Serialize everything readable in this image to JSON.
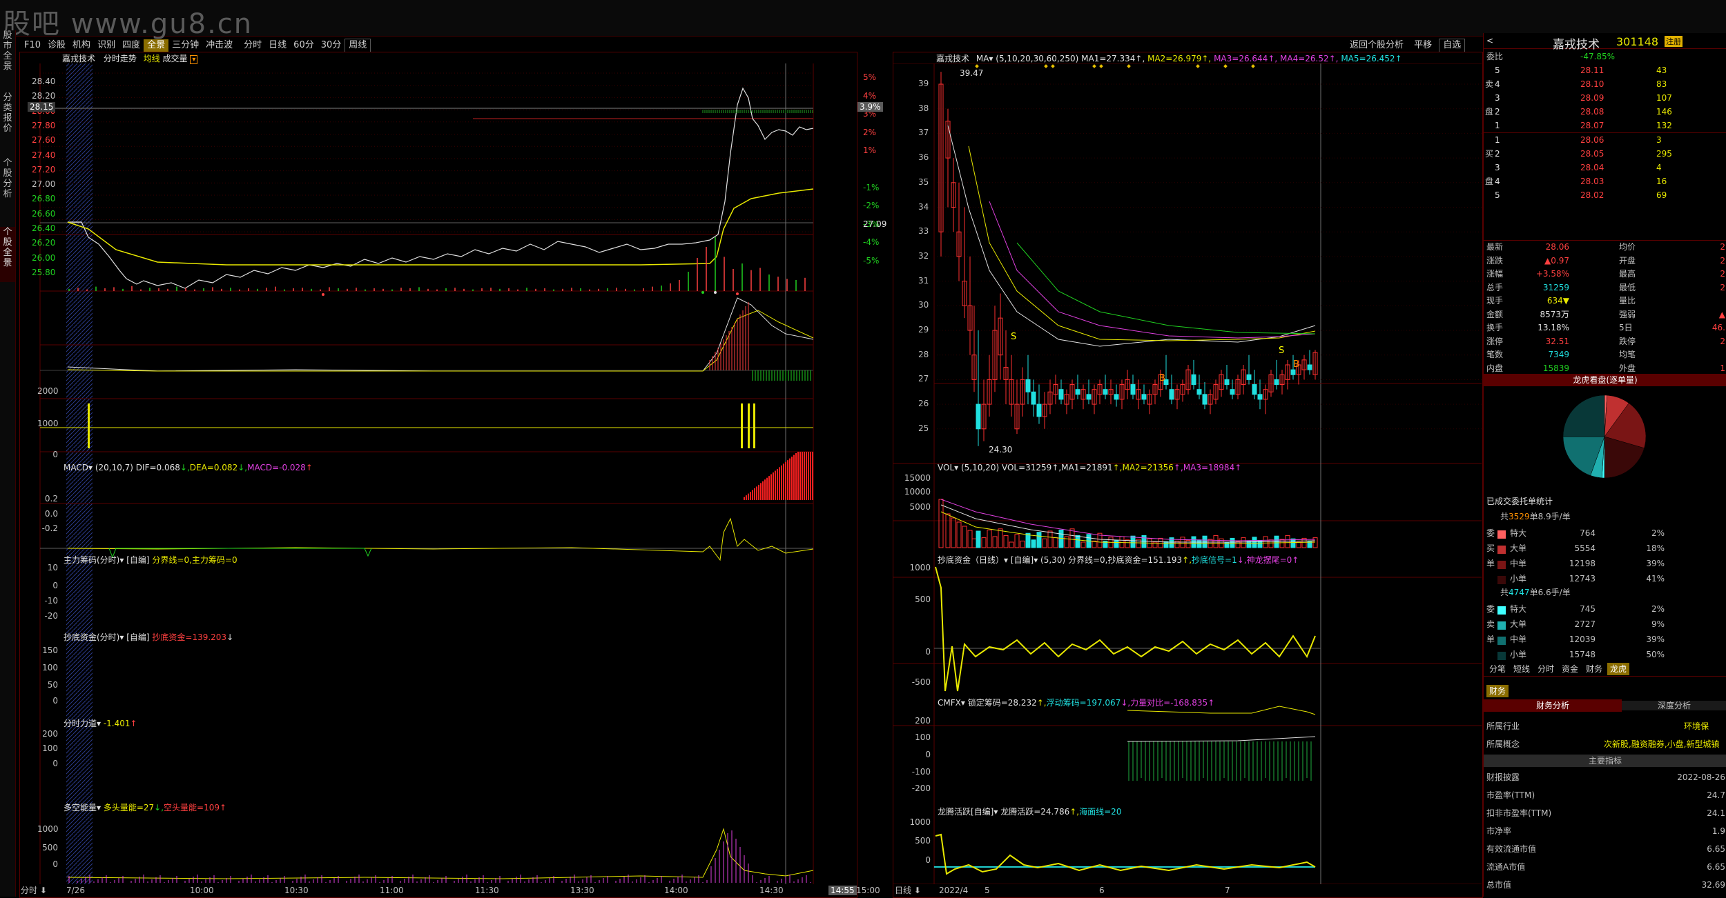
{
  "watermark": "股吧 www.gu8.cn",
  "nav": {
    "items": [
      "F10",
      "诊股",
      "机构",
      "识别",
      "四度",
      "全景",
      "三分钟",
      "冲击波",
      "分时",
      "日线",
      "60分",
      "30分",
      "周线"
    ],
    "active": "全景",
    "right_items": [
      "返回个股分析",
      "平移",
      "自选"
    ]
  },
  "left_tabs": [
    "股市全景",
    "分类报价",
    "个股分析",
    "个股全景"
  ],
  "left_chart": {
    "title": "嘉戎技术",
    "subtitle": "分时走势",
    "avg_label": "均线",
    "vol_label": "成交量",
    "price_ticks": [
      "28.40",
      "28.20",
      "28.00",
      "27.80",
      "27.60",
      "27.40",
      "27.20",
      "27.00",
      "26.80",
      "26.60",
      "26.40",
      "26.20",
      "26.00",
      "25.80"
    ],
    "pct_ticks": [
      "5%",
      "4%",
      "3%",
      "2%",
      "1%",
      "",
      "-1%",
      "-2%",
      "-3%",
      "-4%",
      "-5%"
    ],
    "pre_close": "27.09",
    "current_price": "28.15",
    "current_pct": "3.9%",
    "vol_ticks": [
      "2000",
      "1000",
      "0"
    ],
    "time_ticks": [
      "7/26",
      "10:00",
      "10:30",
      "11:00",
      "11:30",
      "13:30",
      "14:00",
      "14:30",
      "15:00"
    ],
    "time_marker": "14:55",
    "bottom_left": "分时"
  },
  "left_indicators": [
    {
      "name": "MACD",
      "text": "(20,10,7)",
      "dif": "DIF=0.068",
      "dea": "DEA=0.082",
      "macd": "MACD=-0.028",
      "ticks": [
        "0.2",
        "0.0",
        "-0.2"
      ]
    },
    {
      "name": "主力筹码(分时)",
      "text": "[自编]",
      "line": "分界线=0,主力筹码=0",
      "ticks": [
        "10",
        "0",
        "-10",
        "-20"
      ]
    },
    {
      "name": "抄底资金(分时)",
      "text": "[自编]",
      "line": "抄底资金=139.203",
      "ticks": [
        "150",
        "100",
        "50",
        "0"
      ]
    },
    {
      "name": "分时力道",
      "line": "-1.401",
      "ticks": [
        "200",
        "100",
        "0"
      ]
    },
    {
      "name": "多空能量",
      "line": "多头量能=27",
      "line2": "空头量能=109",
      "ticks": [
        "1000",
        "500",
        "0"
      ]
    }
  ],
  "right_chart": {
    "title": "嘉戎技术",
    "ma_label": "MA",
    "ma_params": "(5,10,20,30,60,250)",
    "ma1": "MA1=27.334",
    "ma2": "MA2=26.979",
    "ma3": "MA3=26.644",
    "ma4": "MA4=26.52",
    "ma5": "MA5=26.452",
    "price_ticks": [
      "39",
      "38",
      "37",
      "36",
      "35",
      "34",
      "33",
      "32",
      "31",
      "30",
      "29",
      "28",
      "27",
      "26",
      "25"
    ],
    "high_label": "39.47",
    "low_label": "24.30",
    "date_ticks": [
      "2022/4",
      "5",
      "6",
      "7"
    ],
    "bottom_left": "日线"
  },
  "right_indicators": [
    {
      "name": "VOL",
      "params": "(5,10,20)",
      "line": "VOL=31259",
      "ma1": "MA1=21891",
      "ma2": "MA2=21356",
      "ma3": "MA3=18984",
      "ticks": [
        "15000",
        "10000",
        "5000"
      ]
    },
    {
      "name": "抄底资金（日线）",
      "text": "[自编]",
      "params": "(5,30)",
      "line": "分界线=0,抄底资金=151.193",
      "line2": "抄底信号=1",
      "line3": "神龙摆尾=0",
      "ticks": [
        "1000",
        "500",
        "0",
        "-500"
      ]
    },
    {
      "name": "CMFX",
      "line": "锁定筹码=28.232",
      "line2": "浮动筹码=197.067",
      "line3": "力量对比=-168.835",
      "ticks": [
        "200",
        "100",
        "0",
        "-100",
        "-200"
      ]
    },
    {
      "name": "龙腾活跃[自编]",
      "line": "龙腾活跃=24.786",
      "line2": "海面线=20",
      "ticks": [
        "1000",
        "500",
        "0"
      ]
    }
  ],
  "quote": {
    "name": "嘉戎技术",
    "code": "301148",
    "badge": "注册",
    "weibi_label": "委比",
    "weibi": "-47.85%",
    "asks": [
      {
        "level": "5",
        "price": "28.11",
        "vol": "43"
      },
      {
        "level": "4",
        "price": "28.10",
        "vol": "83"
      },
      {
        "level": "3",
        "price": "28.09",
        "vol": "107"
      },
      {
        "level": "2",
        "price": "28.08",
        "vol": "146"
      },
      {
        "level": "1",
        "price": "28.07",
        "vol": "132"
      }
    ],
    "bids": [
      {
        "level": "1",
        "price": "28.06",
        "vol": "3"
      },
      {
        "level": "2",
        "price": "28.05",
        "vol": "295"
      },
      {
        "level": "3",
        "price": "28.04",
        "vol": "4"
      },
      {
        "level": "4",
        "price": "28.03",
        "vol": "16"
      },
      {
        "level": "5",
        "price": "28.02",
        "vol": "69"
      }
    ],
    "stats": [
      {
        "l1": "最新",
        "v1": "28.06",
        "l2": "均价",
        "v2": "2"
      },
      {
        "l1": "涨跌",
        "v1": "▲0.97",
        "l2": "开盘",
        "v2": "2"
      },
      {
        "l1": "涨幅",
        "v1": "+3.58%",
        "l2": "最高",
        "v2": "2"
      },
      {
        "l1": "总手",
        "v1": "31259",
        "l2": "最低",
        "v2": "2"
      },
      {
        "l1": "现手",
        "v1": "634▼",
        "l2": "量比",
        "v2": ""
      },
      {
        "l1": "金额",
        "v1": "8573万",
        "l2": "强弱",
        "v2": "▲"
      },
      {
        "l1": "换手",
        "v1": "13.18%",
        "l2": "5日",
        "v2": "46."
      },
      {
        "l1": "涨停",
        "v1": "32.51",
        "l2": "跌停",
        "v2": "2"
      },
      {
        "l1": "笔数",
        "v1": "7349",
        "l2": "均笔",
        "v2": ""
      },
      {
        "l1": "内盘",
        "v1": "15839",
        "l2": "外盘",
        "v2": "1"
      }
    ],
    "pie_title": "龙虎看盘(逐单量)",
    "pie_slices": [
      {
        "value": 2,
        "color": "#ff6060"
      },
      {
        "value": 18,
        "color": "#c03030"
      },
      {
        "value": 39,
        "color": "#7a1515"
      },
      {
        "value": 41,
        "color": "#3a0808"
      },
      {
        "value": 2,
        "color": "#40ffff"
      },
      {
        "value": 9,
        "color": "#20b0b0"
      },
      {
        "value": 39,
        "color": "#107070"
      },
      {
        "value": 50,
        "color": "#083838"
      }
    ],
    "order_stat_title": "已成交委托单统计",
    "buy_summary_pre": "共",
    "buy_summary_num": "3529",
    "buy_summary_post": "单8.9手/单",
    "buy_rows": [
      {
        "side": "委",
        "name": "特大",
        "vol": "764",
        "pct": "2%"
      },
      {
        "side": "买",
        "name": "大单",
        "vol": "5554",
        "pct": "18%"
      },
      {
        "side": "单",
        "name": "中单",
        "vol": "12198",
        "pct": "39%"
      },
      {
        "side": "",
        "name": "小单",
        "vol": "12743",
        "pct": "41%"
      }
    ],
    "sell_summary_pre": "共",
    "sell_summary_num": "4747",
    "sell_summary_post": "单6.6手/单",
    "sell_rows": [
      {
        "side": "委",
        "name": "特大",
        "vol": "745",
        "pct": "2%"
      },
      {
        "side": "卖",
        "name": "大单",
        "vol": "2727",
        "pct": "9%"
      },
      {
        "side": "单",
        "name": "中单",
        "vol": "12039",
        "pct": "39%"
      },
      {
        "side": "",
        "name": "小单",
        "vol": "15748",
        "pct": "50%"
      }
    ],
    "tabs": [
      "分笔",
      "短线",
      "分时",
      "资金",
      "财务",
      "龙虎"
    ],
    "active_tab": "龙虎",
    "finance_tab": "财务",
    "finance_tabs": [
      "财务分析",
      "深度分析"
    ],
    "industry_label": "所属行业",
    "industry": "环境保",
    "concept_label": "所属概念",
    "concept": "次新股,融资融券,小盘,新型城镇",
    "main_index": "主要指标",
    "finance_rows": [
      {
        "label": "财报披露",
        "value": "2022-08-26"
      },
      {
        "label": "市盈率(TTM)",
        "value": "24.7"
      },
      {
        "label": "扣非市盈率(TTM)",
        "value": "24.1"
      },
      {
        "label": "市净率",
        "value": "1.9"
      },
      {
        "label": "有效流通市值",
        "value": "6.65"
      },
      {
        "label": "流通A市值",
        "value": "6.65"
      },
      {
        "label": "总市值",
        "value": "32.69"
      }
    ]
  }
}
